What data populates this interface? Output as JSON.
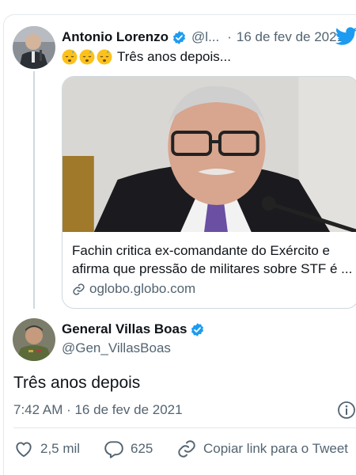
{
  "quoted_tweet": {
    "author_name": "Antonio Lorenzo",
    "handle": "@l...",
    "separator": "·",
    "date": "16 de fev de 2021",
    "text": "Três anos depois...",
    "emojis": [
      "sleeping-face",
      "sleeping-face",
      "sleeping-face"
    ],
    "link_card": {
      "title": "Fachin critica ex-comandante do Exército e afirma que pressão de militares sobre STF é ...",
      "domain": "oglobo.globo.com"
    }
  },
  "main_tweet": {
    "author_name": "General Villas Boas",
    "handle": "@Gen_VillasBoas",
    "text": "Três anos depois",
    "timestamp": "7:42 AM · 16 de fev de 2021"
  },
  "actions": {
    "likes": "2,5 mil",
    "replies": "625",
    "copy_link": "Copiar link para o Tweet"
  },
  "icons": [
    "verified-badge-icon",
    "twitter-bird-icon",
    "link-icon",
    "info-icon",
    "heart-icon",
    "reply-bubble-icon",
    "chain-link-icon"
  ],
  "colors": {
    "brand": "#1d9bf0",
    "secondary_text": "#536471",
    "border": "#cfd9de"
  }
}
